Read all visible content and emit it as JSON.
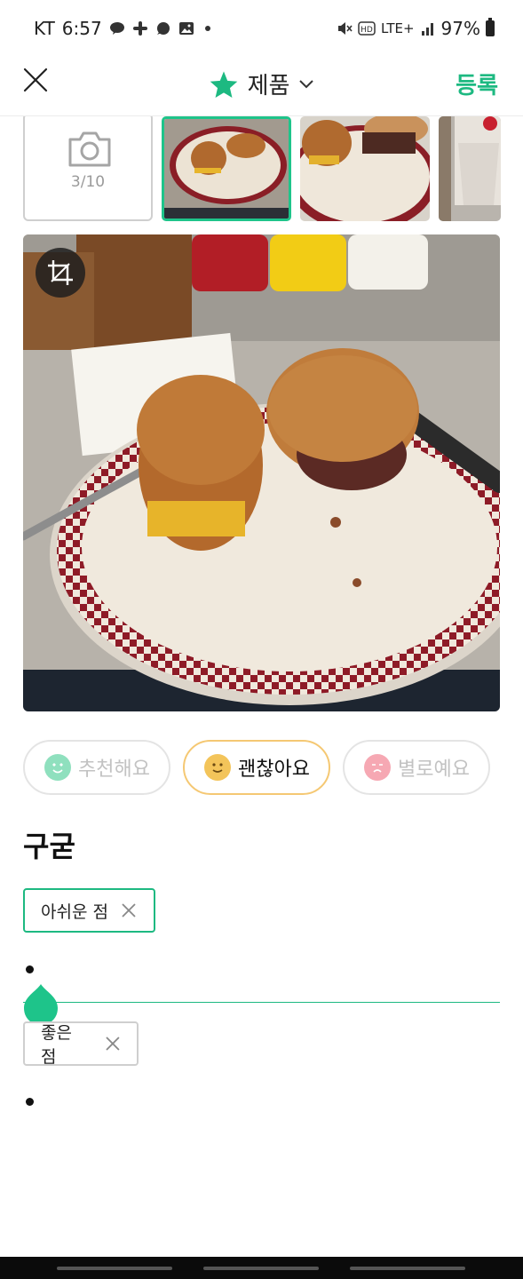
{
  "status_bar": {
    "carrier": "KT",
    "time": "6:57",
    "network": "LTE+",
    "battery": "97%"
  },
  "header": {
    "title": "제품",
    "register_label": "등록"
  },
  "photos": {
    "count_label": "3/10"
  },
  "rating": {
    "options": [
      {
        "label": "추천해요",
        "selected": false
      },
      {
        "label": "괜찮아요",
        "selected": true
      },
      {
        "label": "별로예요",
        "selected": false
      }
    ]
  },
  "product": {
    "name": "구굳"
  },
  "tags": {
    "cons_label": "아쉬운 점",
    "pros_label": "좋은 점"
  },
  "colors": {
    "accent": "#1db981",
    "selected_border": "#f5c873"
  }
}
